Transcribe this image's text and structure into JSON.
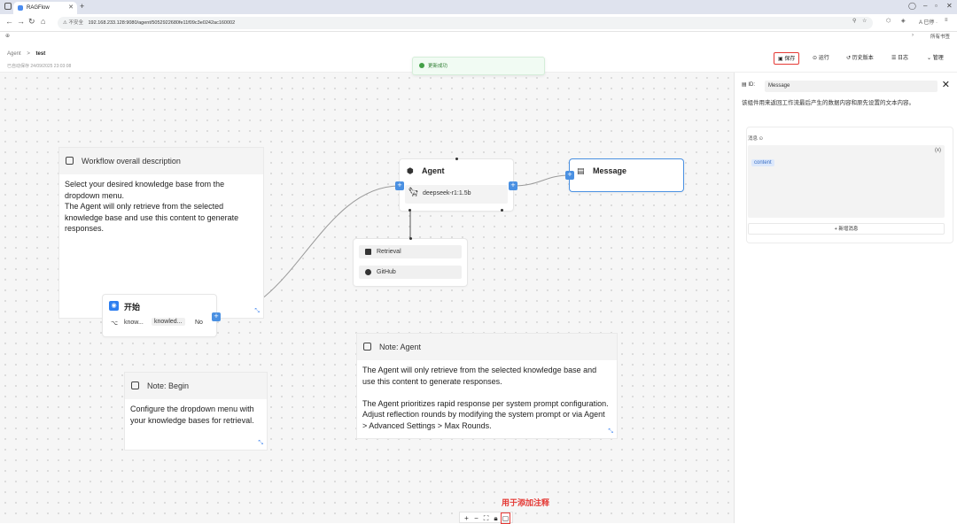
{
  "browser": {
    "tab_title": "RAGFlow",
    "url_warning": "⚠ 不安全",
    "url": "192.168.233.128:9080/agent/5052922680fe11f09c3e0242ac160002",
    "profile": "A 已停 ·",
    "bookmarks": "所有书签"
  },
  "header": {
    "crumb_root": "Agent",
    "crumb_sep": ">",
    "crumb_current": "test",
    "autosave": "已自动保存 24/09/2025 23:03:08",
    "buttons": {
      "save": "保存",
      "run": "运行",
      "history": "历史版本",
      "log": "日志",
      "manage": "管理"
    }
  },
  "toast": {
    "text": "更新成功"
  },
  "notes": {
    "workflow": {
      "title": "Workflow overall description",
      "body": "Select your desired knowledge base from the dropdown menu.\nThe Agent will only retrieve from the selected knowledge base and use this content  to generate responses."
    },
    "begin": {
      "title": "Note: Begin",
      "body": "Configure the dropdown menu with your knowledge bases for retrieval."
    },
    "agent": {
      "title": "Note: Agent",
      "body": "The Agent will only retrieve from the selected knowledge base and use this content  to generate responses.\n\nThe Agent prioritizes rapid response per system prompt configuration. Adjust reflection rounds by modifying the system prompt or via Agent > Advanced Settings > Max Rounds."
    }
  },
  "nodes": {
    "begin": {
      "title": "开始",
      "param_name": "know...",
      "param_value": "knowled...",
      "param_flag": "No"
    },
    "agent": {
      "title": "Agent",
      "model": "deepseek-r1:1.5b"
    },
    "message": {
      "title": "Message"
    },
    "tools": {
      "retrieval": "Retrieval",
      "github": "GitHub"
    }
  },
  "panel": {
    "id_label": "ID:",
    "id_value": "Message",
    "description": "该组件用来返回工作流最后产生的数据内容和原先设置的文本内容。",
    "message_label": "消息 ⊙",
    "vars_icon": "(x)",
    "content_tag": "content",
    "add_message": "+ 新增消息"
  },
  "canvas_controls": {
    "zoom_in": "+",
    "zoom_out": "−",
    "fit": "⛶",
    "lock": "🔒︎",
    "add_note": "▢"
  },
  "annotation": "用于添加注释",
  "colors": {
    "accent": "#4a90e2",
    "highlight": "#e53935",
    "success": "#43a047"
  }
}
